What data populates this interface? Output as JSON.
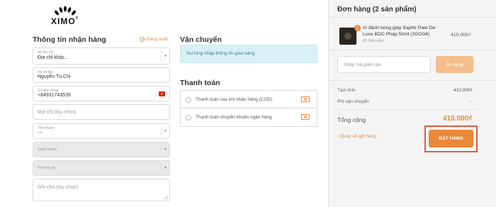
{
  "brand": {
    "logo_text": "XIMO"
  },
  "shipping_info": {
    "title": "Thông tin nhận hàng",
    "logout_label": "Đăng xuất",
    "saved_address": {
      "label": "Sổ địa chỉ",
      "value": "Địa chỉ khác..."
    },
    "full_name": {
      "label": "Họ và tên",
      "value": "Nguyễn Tú Chi"
    },
    "phone": {
      "label": "Số điện thoại",
      "value": "+84931743539"
    },
    "address": {
      "placeholder": "Địa chỉ (tùy chọn)"
    },
    "province": {
      "label": "Tỉnh thành",
      "value": "---"
    },
    "district": {
      "placeholder": "Quận huyện"
    },
    "ward": {
      "placeholder": "Phường xã"
    },
    "note": {
      "placeholder": "Ghi chú (tùy chọn)"
    }
  },
  "delivery": {
    "title": "Vận chuyển",
    "notice": "Vui lòng nhập thông tin giao hàng"
  },
  "payment": {
    "title": "Thanh toán",
    "options": [
      {
        "label": "Thanh toán sau khi nhận hàng (COD)"
      },
      {
        "label": "Thanh toán chuyển khoản ngân hàng"
      }
    ]
  },
  "order": {
    "title": "Đơn hàng (2 sản phẩm)",
    "item": {
      "name": "Xi đánh bóng giày Saphir Pate De Luxe BDC Pháp 50ml (XDG04)",
      "variant": "05 Nâu sẫm",
      "price": "410.000₫",
      "qty": "2"
    },
    "coupon_placeholder": "Nhập mã giảm giá",
    "apply_label": "Áp dụng",
    "subtotal_label": "Tạm tính",
    "subtotal_value": "410.000₫",
    "shipping_label": "Phí vận chuyển",
    "shipping_value": "-",
    "total_label": "Tổng cộng",
    "total_value": "410.000₫",
    "back_label": "Quay về giỏ hàng",
    "checkout_label": "ĐẶT HÀNG"
  },
  "colors": {
    "accent": "#e8893a",
    "highlight_frame": "#e05a42",
    "notice_bg": "#d8eff6"
  }
}
